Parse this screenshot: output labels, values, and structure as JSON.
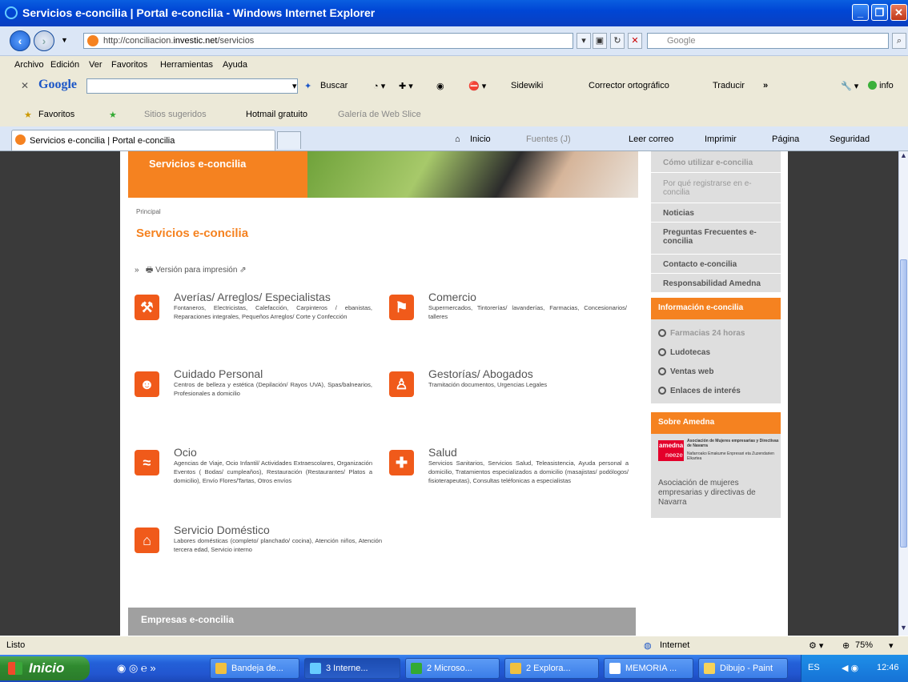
{
  "window": {
    "title": "Servicios e-concilia | Portal e-concilia - Windows Internet Explorer"
  },
  "address": {
    "url_prefix": "http://conciliacion.",
    "url_domain": "investic.net",
    "url_path": "/servicios",
    "search_placeholder": "Google"
  },
  "menu": [
    "Archivo",
    "Edición",
    "Ver",
    "Favoritos",
    "Herramientas",
    "Ayuda"
  ],
  "gtoolbar": {
    "logo": "Google",
    "buscar": "Buscar",
    "sidewiki": "Sidewiki",
    "corrector": "Corrector ortográfico",
    "traducir": "Traducir",
    "info": "info"
  },
  "favorites": {
    "label": "Favoritos",
    "sitios": "Sitios sugeridos",
    "hotmail": "Hotmail gratuito",
    "galeria": "Galería de Web Slice"
  },
  "tab": {
    "title": "Servicios e-concilia | Portal e-concilia"
  },
  "commandbar": {
    "inicio": "Inicio",
    "fuentes": "Fuentes (J)",
    "leer": "Leer correo",
    "imprimir": "Imprimir",
    "pagina": "Página",
    "seguridad": "Seguridad"
  },
  "page": {
    "hero_title": "Servicios e-concilia",
    "breadcrumb": "Principal",
    "title": "Servicios e-concilia",
    "print": "Versión para impresión",
    "services": [
      {
        "title": "Averías/ Arreglos/ Especialistas",
        "desc": "Fontaneros, Electricistas, Calefacción, Carpinteros / ebanistas, Reparaciones integrales, Pequeños Arreglos/ Corte y Confección",
        "icon": "wrench-icon"
      },
      {
        "title": "Comercio",
        "desc": "Supermercados, Tintorerías/ lavanderías, Farmacias, Concesionarios/ talleres",
        "icon": "shop-icon"
      },
      {
        "title": "Cuidado Personal",
        "desc": "Centros de belleza y estética (Depilación/ Rayos UVA), Spas/balnearios, Profesionales a domicilio",
        "icon": "smiley-icon"
      },
      {
        "title": "Gestorías/ Abogados",
        "desc": "Tramitación documentos, Urgencias Legales",
        "icon": "lawyer-icon"
      },
      {
        "title": "Ocio",
        "desc": "Agencias de Viaje, Ocio Infantil/ Actividades Extraescolares, Organización Eventos ( Bodas/ cumpleaños), Restauración (Restaurantes/ Platos a domicilio), Envío Flores/Tartas, Otros envíos",
        "icon": "swimmer-icon"
      },
      {
        "title": "Salud",
        "desc": "Servicios Sanitarios, Servicios Salud, Teleasistencia, Ayuda personal a domicilio, Tratamientos especializados a domicilio (masajistas/ podólogos/ fisioterapeutas), Consultas teléfonicas a especialistas",
        "icon": "cross-icon"
      },
      {
        "title": "Servicio Doméstico",
        "desc": "Labores domésticas (completo/ planchado/ cocina), Atención niños, Atención tercera edad, Servicio interno",
        "icon": "house-icon"
      }
    ],
    "empresas": "Empresas e-concilia"
  },
  "sidebar": {
    "items": [
      "Cómo utilizar e-concilia",
      "Por qué registrarse en e-concilia",
      "Noticias",
      "Preguntas Frecuentes e-concilia",
      "Contacto e-concilia",
      "Responsabilidad Amedna"
    ],
    "info_head": "Información e-concilia",
    "info_items": [
      "Farmacias 24 horas",
      "Ludotecas",
      "Ventas web",
      "Enlaces de interés"
    ],
    "sobre_head": "Sobre Amedna",
    "amedna_logo1": "amedna",
    "amedna_logo2": "neeze",
    "amedna_org": "Asociación de Mujeres empresarias y Directivas de Navarra",
    "amedna_sub": "Nafarroako Emakume Enpresari eta Zuzendarien Elkartea",
    "amedna_text": "Asociación de mujeres empresarias y directivas de Navarra"
  },
  "status": {
    "text": "Listo",
    "zone": "Internet",
    "zoom": "75%"
  },
  "taskbar": {
    "start": "Inicio",
    "buttons": [
      "Bandeja de...",
      "3 Interne...",
      "2 Microso...",
      "2 Explora...",
      "MEMORIA ...",
      "Dibujo - Paint"
    ],
    "lang": "ES",
    "clock": "12:46"
  }
}
